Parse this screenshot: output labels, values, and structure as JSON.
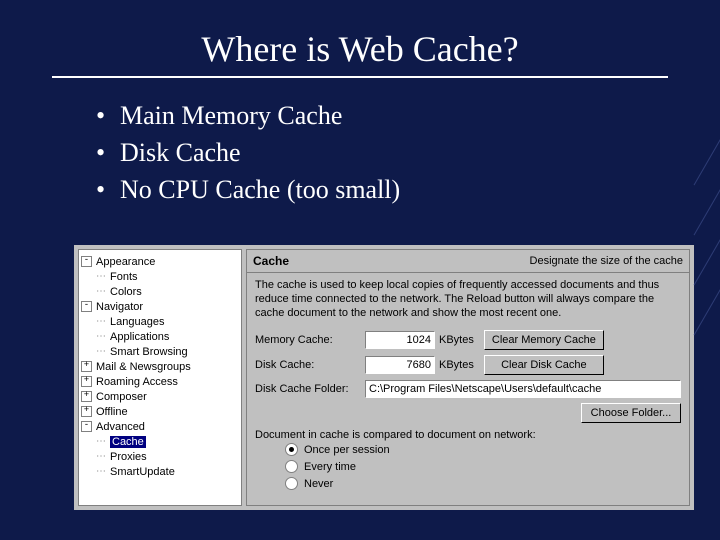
{
  "slide": {
    "title": "Where is Web Cache?",
    "bullets": [
      "Main Memory Cache",
      "Disk Cache",
      "No CPU Cache (too small)"
    ]
  },
  "prefs": {
    "tree": {
      "appearance": "Appearance",
      "fonts": "Fonts",
      "colors": "Colors",
      "navigator": "Navigator",
      "languages": "Languages",
      "applications": "Applications",
      "smart_browsing": "Smart Browsing",
      "mail_news": "Mail & Newsgroups",
      "roaming": "Roaming Access",
      "composer": "Composer",
      "offline": "Offline",
      "advanced": "Advanced",
      "cache": "Cache",
      "proxies": "Proxies",
      "smartupdate": "SmartUpdate"
    },
    "header": {
      "title": "Cache",
      "subtitle": "Designate the size of the cache"
    },
    "help": "The cache is used to keep local copies of frequently accessed documents and thus reduce time connected to the network. The Reload button will always compare the cache document to the network and show the most recent one.",
    "memory": {
      "label": "Memory Cache:",
      "value": "1024",
      "unit": "KBytes",
      "button": "Clear Memory Cache"
    },
    "disk": {
      "label": "Disk Cache:",
      "value": "7680",
      "unit": "KBytes",
      "button": "Clear Disk Cache"
    },
    "folder": {
      "label": "Disk Cache Folder:",
      "path": "C:\\Program Files\\Netscape\\Users\\default\\cache",
      "choose": "Choose Folder..."
    },
    "compare": {
      "label": "Document in cache is compared to document on network:",
      "opt1": "Once per session",
      "opt2": "Every time",
      "opt3": "Never"
    }
  }
}
